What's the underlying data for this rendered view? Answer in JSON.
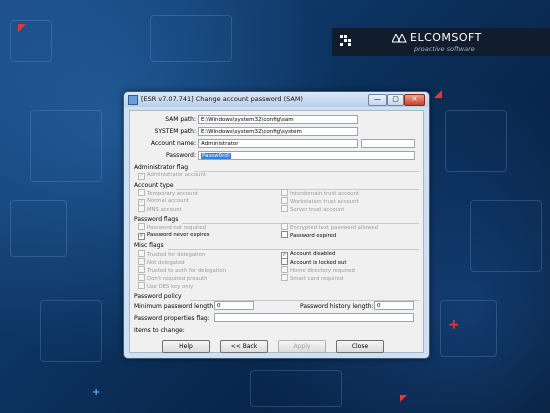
{
  "brand": {
    "name": "ELCOMSOFT",
    "tagline": "proactive software"
  },
  "window": {
    "title": "[ESR v7.07.741]  Change account password (SAM)",
    "controls": {
      "minimize": "—",
      "maximize": "▢",
      "close": "✕"
    }
  },
  "form": {
    "sam_path": {
      "label": "SAM path:",
      "value": "E:\\Windows\\system32\\config\\sam"
    },
    "system_path": {
      "label": "SYSTEM path:",
      "value": "E:\\Windows\\system32\\config\\system"
    },
    "account_name": {
      "label": "Account name:",
      "value": "Administrator"
    },
    "rid": "RID: 000001F4",
    "password": {
      "label": "Password:",
      "value": "Passw0rd!"
    }
  },
  "admin_flag": {
    "title": "Administrator flag",
    "items": [
      {
        "label": "Administrator account",
        "checked": true,
        "disabled": true
      }
    ]
  },
  "account_type": {
    "title": "Account type",
    "left": [
      {
        "label": "Temporary account",
        "checked": false,
        "disabled": true
      },
      {
        "label": "Normal account",
        "checked": true,
        "disabled": true
      },
      {
        "label": "MNS account",
        "checked": false,
        "disabled": true
      }
    ],
    "right": [
      {
        "label": "Interdomain trust account",
        "checked": false,
        "disabled": true
      },
      {
        "label": "Workstation trust account",
        "checked": false,
        "disabled": true
      },
      {
        "label": "Server trust account",
        "checked": false,
        "disabled": true
      }
    ]
  },
  "password_flags": {
    "title": "Password flags",
    "left": [
      {
        "label": "Password not required",
        "checked": false,
        "disabled": true
      },
      {
        "label": "Password never expires",
        "checked": true,
        "disabled": false
      }
    ],
    "right": [
      {
        "label": "Encrypted text password allowed",
        "checked": false,
        "disabled": true
      },
      {
        "label": "Password expired",
        "checked": false,
        "disabled": false
      }
    ]
  },
  "misc_flags": {
    "title": "Misc flags",
    "left": [
      {
        "label": "Trusted for delegation",
        "checked": false,
        "disabled": true
      },
      {
        "label": "Not delegated",
        "checked": false,
        "disabled": true
      },
      {
        "label": "Trusted to auth for delegation",
        "checked": false,
        "disabled": true
      },
      {
        "label": "Don't required preauth",
        "checked": false,
        "disabled": true
      },
      {
        "label": "Use DES key only",
        "checked": false,
        "disabled": true
      }
    ],
    "right": [
      {
        "label": "Account disabled",
        "checked": true,
        "disabled": false
      },
      {
        "label": "Account is locked out",
        "checked": false,
        "disabled": false
      },
      {
        "label": "Home directory required",
        "checked": false,
        "disabled": true
      },
      {
        "label": "Smart card required",
        "checked": false,
        "disabled": true
      }
    ]
  },
  "policy": {
    "title": "Password policy",
    "min_length": {
      "label": "Minimum password length:",
      "value": "0"
    },
    "history_length": {
      "label": "Password history length:",
      "value": "0"
    },
    "properties": {
      "label": "Password properties flag:",
      "value": ""
    }
  },
  "items_to_change": "Items to change:",
  "buttons": {
    "help": "Help",
    "back": "<< Back",
    "apply": "Apply",
    "close": "Close"
  }
}
